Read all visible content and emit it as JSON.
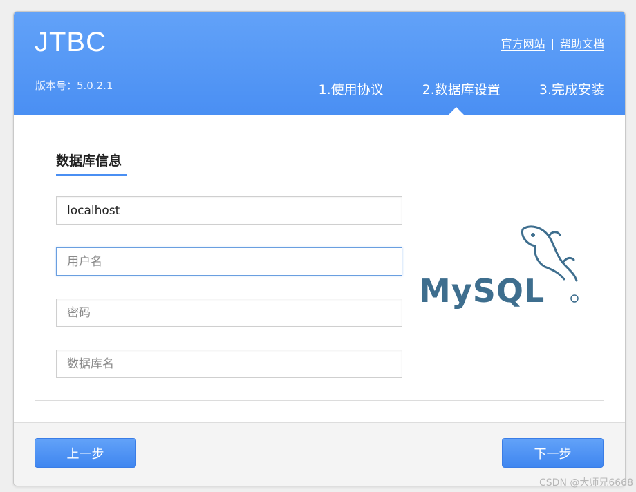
{
  "header": {
    "brand": "JTBC",
    "version": "版本号：5.0.2.1",
    "links": {
      "official_site": "官方网站",
      "separator": "|",
      "help_docs": "帮助文档"
    },
    "steps": [
      "1.使用协议",
      "2.数据库设置",
      "3.完成安装"
    ],
    "active_step": 2
  },
  "panel": {
    "section_title": "数据库信息",
    "fields": {
      "host": {
        "value": "localhost",
        "placeholder": ""
      },
      "username": {
        "value": "",
        "placeholder": "用户名"
      },
      "password": {
        "value": "",
        "placeholder": "密码"
      },
      "dbname": {
        "value": "",
        "placeholder": "数据库名"
      }
    },
    "logo": {
      "text": "MySQL",
      "icon": "dolphin-icon"
    }
  },
  "footer": {
    "prev_label": "上一步",
    "next_label": "下一步"
  },
  "watermark": "CSDN @大师兄6668",
  "colors": {
    "accent": "#4a8ff3",
    "logo": "#3e6e8e"
  }
}
